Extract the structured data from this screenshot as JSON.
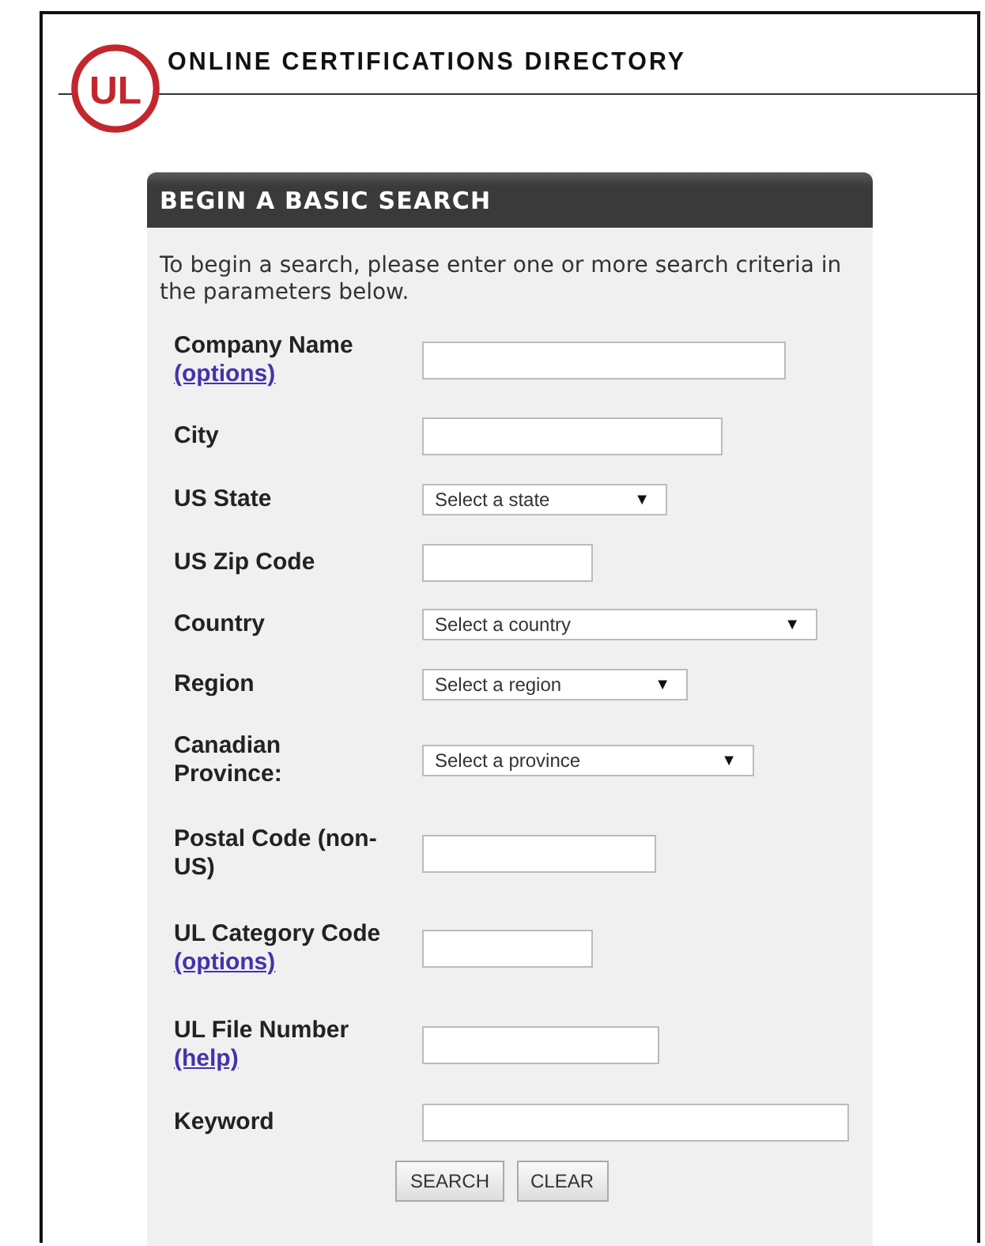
{
  "header": {
    "logo": "UL",
    "title": "ONLINE CERTIFICATIONS DIRECTORY"
  },
  "panel": {
    "title": "BEGIN A BASIC SEARCH",
    "intro": "To begin a search, please enter one or more search criteria in the parameters below.",
    "fields": [
      {
        "kind": "text",
        "label": "Company Name",
        "link": "(options)"
      },
      {
        "kind": "text",
        "label": "City"
      },
      {
        "kind": "select",
        "label": "US State",
        "value": "Select a state",
        "arrow": "▼"
      },
      {
        "kind": "text",
        "label": "US Zip Code"
      },
      {
        "kind": "select",
        "label": "Country",
        "value": "Select a country",
        "arrow": "▼"
      },
      {
        "kind": "select",
        "label": "Region",
        "value": "Select a region",
        "arrow": "▼"
      },
      {
        "kind": "select",
        "label": "Canadian Province:",
        "value": "Select a province",
        "arrow": "▼"
      },
      {
        "kind": "text",
        "label": "Postal Code (non-US)"
      },
      {
        "kind": "text",
        "label": "UL Category Code",
        "link": "(options)"
      },
      {
        "kind": "text",
        "label": "UL File Number",
        "link": "(help)"
      },
      {
        "kind": "text",
        "label": "Keyword"
      }
    ],
    "buttons": [
      "SEARCH",
      "CLEAR"
    ]
  }
}
